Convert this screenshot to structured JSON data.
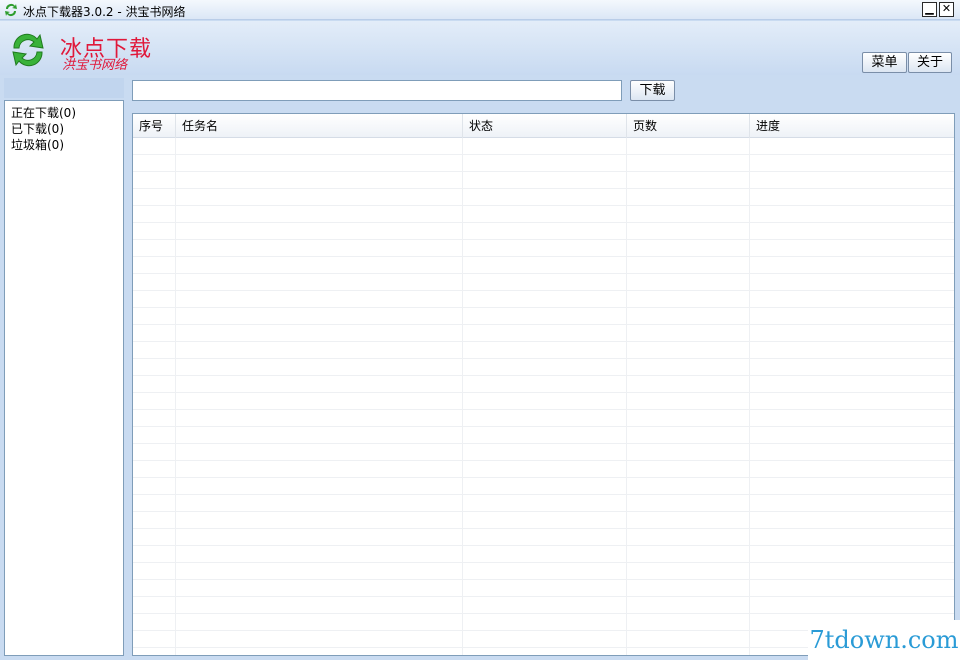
{
  "window": {
    "title": "冰点下载器3.0.2 - 洪宝书网络",
    "minimize_glyph": "▁",
    "close_glyph": "✕"
  },
  "header": {
    "brand": "冰点下载",
    "sub_brand": "洪宝书网络",
    "menu_label": "菜单",
    "about_label": "关于"
  },
  "sidebar": {
    "items": [
      {
        "label": "正在下载(0)"
      },
      {
        "label": "已下载(0)"
      },
      {
        "label": "垃圾箱(0)"
      }
    ]
  },
  "toolbar": {
    "url_value": "",
    "download_label": "下载"
  },
  "table": {
    "columns": [
      {
        "label": "序号"
      },
      {
        "label": "任务名"
      },
      {
        "label": "状态"
      },
      {
        "label": "页数"
      },
      {
        "label": "进度"
      }
    ],
    "rows": []
  },
  "watermark": "7tdown.com",
  "colors": {
    "brand": "#e0183a",
    "window_bg": "#c9dbf1",
    "watermark": "#2a9bd6"
  }
}
